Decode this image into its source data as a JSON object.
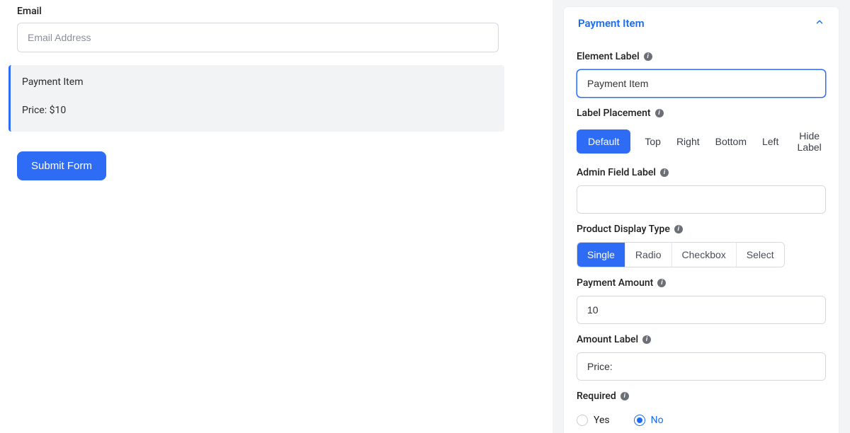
{
  "form": {
    "email": {
      "label": "Email",
      "placeholder": "Email Address"
    },
    "payment": {
      "title": "Payment Item",
      "price_label": "Price:",
      "price_value": "$10"
    },
    "submit_label": "Submit Form"
  },
  "panel": {
    "header_title": "Payment Item",
    "element_label": {
      "label": "Element Label",
      "value": "Payment Item"
    },
    "label_placement": {
      "label": "Label Placement",
      "options": {
        "default": "Default",
        "top": "Top",
        "right": "Right",
        "bottom": "Bottom",
        "left": "Left",
        "hide": "Hide Label"
      }
    },
    "admin_field_label": {
      "label": "Admin Field Label",
      "value": ""
    },
    "product_display_type": {
      "label": "Product Display Type",
      "options": {
        "single": "Single",
        "radio": "Radio",
        "checkbox": "Checkbox",
        "select": "Select"
      }
    },
    "payment_amount": {
      "label": "Payment Amount",
      "value": "10"
    },
    "amount_label": {
      "label": "Amount Label",
      "value": "Price:"
    },
    "required": {
      "label": "Required",
      "yes": "Yes",
      "no": "No"
    }
  }
}
